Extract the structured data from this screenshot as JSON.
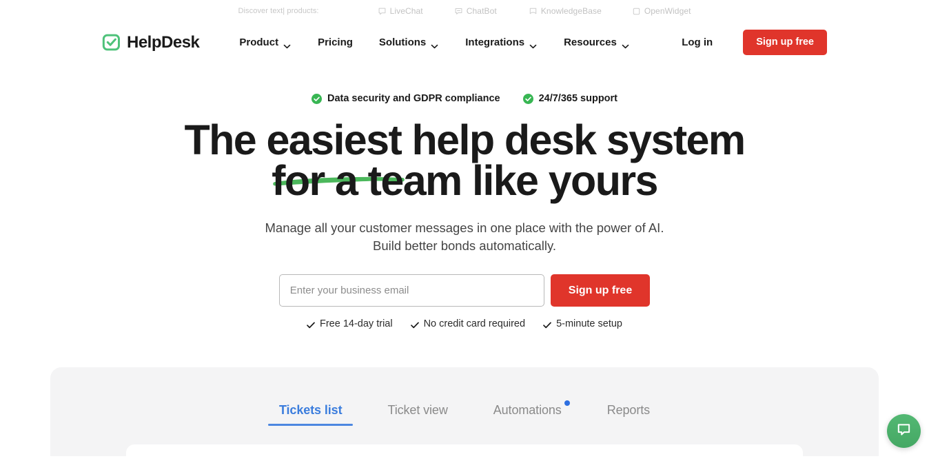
{
  "topbar": {
    "label": "Discover text| products:",
    "products": [
      {
        "name": "LiveChat",
        "icon": "chat-bubble-icon"
      },
      {
        "name": "ChatBot",
        "icon": "chatbot-icon"
      },
      {
        "name": "KnowledgeBase",
        "icon": "book-icon"
      },
      {
        "name": "OpenWidget",
        "icon": "widget-icon"
      }
    ]
  },
  "nav": {
    "brand": "HelpDesk",
    "brand_logo_color": "#4ec27a",
    "items": [
      {
        "label": "Product",
        "has_dropdown": true
      },
      {
        "label": "Pricing",
        "has_dropdown": false
      },
      {
        "label": "Solutions",
        "has_dropdown": true
      },
      {
        "label": "Integrations",
        "has_dropdown": true
      },
      {
        "label": "Resources",
        "has_dropdown": true
      }
    ],
    "login": "Log in",
    "signup": "Sign up free",
    "cta_color": "#e0352b"
  },
  "hero": {
    "badges": [
      "Data security and GDPR compliance",
      "24/7/365 support"
    ],
    "badge_color": "#38b653",
    "headline_line1": "The easiest help desk system",
    "headline_line2": "for a team like yours",
    "underline_color": "#4cb85c",
    "subhead_line1": "Manage all your customer messages in one place with the power of AI.",
    "subhead_line2": "Build better bonds automatically.",
    "email_placeholder": "Enter your business email",
    "email_value": "",
    "signup_button": "Sign up free",
    "perks": [
      "Free 14-day trial",
      "No credit card required",
      "5-minute setup"
    ]
  },
  "showcase": {
    "tabs": [
      {
        "label": "Tickets list",
        "active": true,
        "badge_dot": false
      },
      {
        "label": "Ticket view",
        "active": false,
        "badge_dot": false
      },
      {
        "label": "Automations",
        "active": false,
        "badge_dot": true
      },
      {
        "label": "Reports",
        "active": false,
        "badge_dot": false
      }
    ],
    "active_color": "#3b7ddd"
  },
  "chat_widget": {
    "icon": "chat-bubble-icon",
    "color": "#4caf6d"
  }
}
